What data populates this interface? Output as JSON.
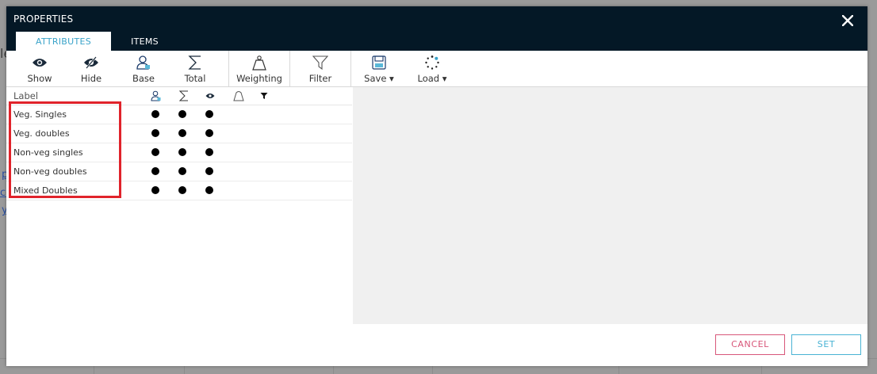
{
  "background": {
    "fragments": [
      "le",
      "p",
      "cc",
      "y"
    ]
  },
  "dialog": {
    "title": "PROPERTIES",
    "tabs": [
      {
        "label": "ATTRIBUTES",
        "active": true
      },
      {
        "label": "ITEMS",
        "active": false
      }
    ]
  },
  "toolbar": {
    "show": "Show",
    "hide": "Hide",
    "base": "Base",
    "total": "Total",
    "weighting": "Weighting",
    "filter": "Filter",
    "save": "Save ▾",
    "load": "Load ▾"
  },
  "list": {
    "header_label": "Label",
    "header_icons": [
      "base-icon",
      "sum-icon",
      "eye-icon",
      "weight-icon",
      "filter-icon"
    ],
    "rows": [
      {
        "label": "Veg. Singles",
        "base": true,
        "total": true,
        "show": true
      },
      {
        "label": "Veg. doubles",
        "base": true,
        "total": true,
        "show": true
      },
      {
        "label": "Non-veg singles",
        "base": true,
        "total": true,
        "show": true
      },
      {
        "label": "Non-veg doubles",
        "base": true,
        "total": true,
        "show": true
      },
      {
        "label": "Mixed Doubles",
        "base": true,
        "total": true,
        "show": true
      }
    ]
  },
  "footer": {
    "cancel": "CANCEL",
    "set": "SET"
  },
  "colors": {
    "titlebar": "#041826",
    "accent": "#3aa3c9",
    "cancel": "#d8577a",
    "highlight": "#e0232b"
  }
}
